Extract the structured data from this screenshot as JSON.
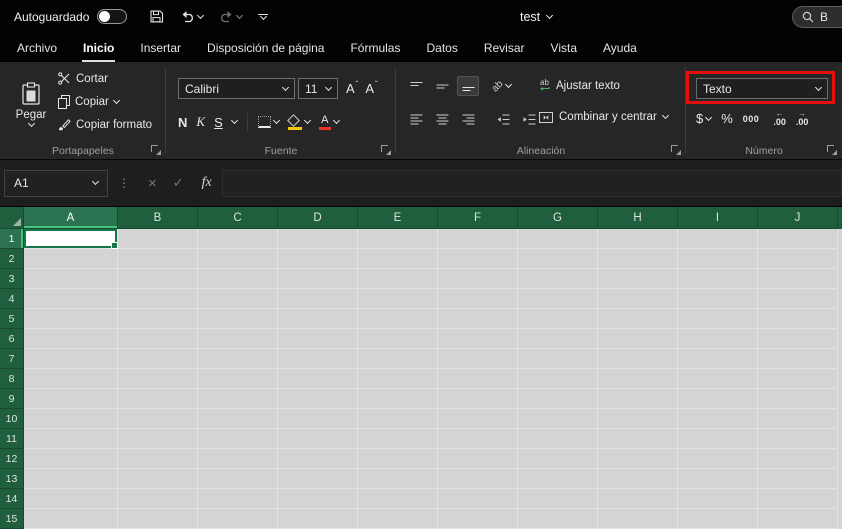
{
  "colors": {
    "header_green": "#1f5f3d",
    "selected_header_green": "#2b7350",
    "selection_border_green": "#13774b",
    "highlight_red": "#e40f0f",
    "cell_gray": "#d4d4d4",
    "fill_color_swatch": "#f2c811",
    "font_color_swatch": "#e8352c"
  },
  "title_bar": {
    "autosave_label": "Autoguardado",
    "document_title": "test",
    "search_text": "B"
  },
  "ribbon_tabs": [
    "Archivo",
    "Inicio",
    "Insertar",
    "Disposición de página",
    "Fórmulas",
    "Datos",
    "Revisar",
    "Vista",
    "Ayuda"
  ],
  "active_tab": "Inicio",
  "clipboard": {
    "group_label": "Portapapeles",
    "paste_label": "Pegar",
    "cut_label": "Cortar",
    "copy_label": "Copiar",
    "format_painter_label": "Copiar formato"
  },
  "font": {
    "group_label": "Fuente",
    "font_name": "Calibri",
    "font_size": "11",
    "bold_label": "N",
    "italic_label": "K",
    "underline_label": "S",
    "letter_label": "A"
  },
  "alignment": {
    "group_label": "Alineación",
    "ab_icon_text": "ab",
    "wrap_text_label": "Ajustar texto",
    "merge_center_label": "Combinar y centrar"
  },
  "number": {
    "group_label": "Número",
    "format_value": "Texto",
    "currency_label": "$",
    "percent_label": "%",
    "thousands_label": "000"
  },
  "formula_bar": {
    "name_box_value": "A1",
    "fx_label": "fx",
    "formula_value": ""
  },
  "grid": {
    "columns": [
      "A",
      "B",
      "C",
      "D",
      "E",
      "F",
      "G",
      "H",
      "I",
      "J"
    ],
    "rows": [
      "1",
      "2",
      "3",
      "4",
      "5",
      "6",
      "7",
      "8",
      "9",
      "10",
      "11",
      "12",
      "13",
      "14",
      "15"
    ],
    "selected_cell": "A1",
    "selected_column": "A",
    "selected_row": "1"
  }
}
